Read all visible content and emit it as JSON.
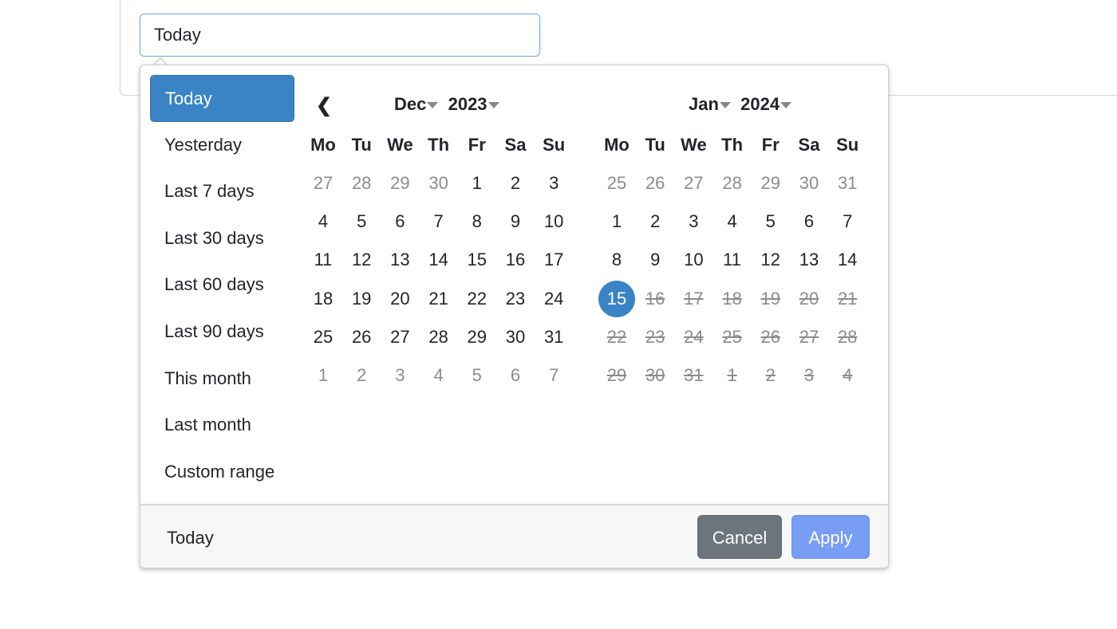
{
  "input": {
    "value": "Today"
  },
  "ranges": [
    {
      "label": "Today",
      "active": true
    },
    {
      "label": "Yesterday"
    },
    {
      "label": "Last 7 days"
    },
    {
      "label": "Last 30 days"
    },
    {
      "label": "Last 60 days"
    },
    {
      "label": "Last 90 days"
    },
    {
      "label": "This month"
    },
    {
      "label": "Last month"
    },
    {
      "label": "Custom range"
    }
  ],
  "weekdays": [
    "Mo",
    "Tu",
    "We",
    "Th",
    "Fr",
    "Sa",
    "Su"
  ],
  "prev_icon": "chevron-left-icon",
  "calendars": [
    {
      "month": "Dec",
      "year": "2023",
      "weeks": [
        [
          {
            "d": "27",
            "s": "off"
          },
          {
            "d": "28",
            "s": "off"
          },
          {
            "d": "29",
            "s": "off"
          },
          {
            "d": "30",
            "s": "off"
          },
          {
            "d": "1"
          },
          {
            "d": "2"
          },
          {
            "d": "3"
          }
        ],
        [
          {
            "d": "4"
          },
          {
            "d": "5"
          },
          {
            "d": "6"
          },
          {
            "d": "7"
          },
          {
            "d": "8"
          },
          {
            "d": "9"
          },
          {
            "d": "10"
          }
        ],
        [
          {
            "d": "11"
          },
          {
            "d": "12"
          },
          {
            "d": "13"
          },
          {
            "d": "14"
          },
          {
            "d": "15"
          },
          {
            "d": "16"
          },
          {
            "d": "17"
          }
        ],
        [
          {
            "d": "18"
          },
          {
            "d": "19"
          },
          {
            "d": "20"
          },
          {
            "d": "21"
          },
          {
            "d": "22"
          },
          {
            "d": "23"
          },
          {
            "d": "24"
          }
        ],
        [
          {
            "d": "25"
          },
          {
            "d": "26"
          },
          {
            "d": "27"
          },
          {
            "d": "28"
          },
          {
            "d": "29"
          },
          {
            "d": "30"
          },
          {
            "d": "31"
          }
        ],
        [
          {
            "d": "1",
            "s": "off"
          },
          {
            "d": "2",
            "s": "off"
          },
          {
            "d": "3",
            "s": "off"
          },
          {
            "d": "4",
            "s": "off"
          },
          {
            "d": "5",
            "s": "off"
          },
          {
            "d": "6",
            "s": "off"
          },
          {
            "d": "7",
            "s": "off"
          }
        ]
      ]
    },
    {
      "month": "Jan",
      "year": "2024",
      "weeks": [
        [
          {
            "d": "25",
            "s": "off"
          },
          {
            "d": "26",
            "s": "off"
          },
          {
            "d": "27",
            "s": "off"
          },
          {
            "d": "28",
            "s": "off"
          },
          {
            "d": "29",
            "s": "off"
          },
          {
            "d": "30",
            "s": "off"
          },
          {
            "d": "31",
            "s": "off"
          }
        ],
        [
          {
            "d": "1"
          },
          {
            "d": "2"
          },
          {
            "d": "3"
          },
          {
            "d": "4"
          },
          {
            "d": "5"
          },
          {
            "d": "6"
          },
          {
            "d": "7"
          }
        ],
        [
          {
            "d": "8"
          },
          {
            "d": "9"
          },
          {
            "d": "10"
          },
          {
            "d": "11"
          },
          {
            "d": "12"
          },
          {
            "d": "13"
          },
          {
            "d": "14"
          }
        ],
        [
          {
            "d": "15",
            "s": "active"
          },
          {
            "d": "16",
            "s": "disabled"
          },
          {
            "d": "17",
            "s": "disabled"
          },
          {
            "d": "18",
            "s": "disabled"
          },
          {
            "d": "19",
            "s": "disabled"
          },
          {
            "d": "20",
            "s": "disabled"
          },
          {
            "d": "21",
            "s": "disabled"
          }
        ],
        [
          {
            "d": "22",
            "s": "disabled"
          },
          {
            "d": "23",
            "s": "disabled"
          },
          {
            "d": "24",
            "s": "disabled"
          },
          {
            "d": "25",
            "s": "disabled"
          },
          {
            "d": "26",
            "s": "disabled"
          },
          {
            "d": "27",
            "s": "disabled"
          },
          {
            "d": "28",
            "s": "disabled"
          }
        ],
        [
          {
            "d": "29",
            "s": "disabled"
          },
          {
            "d": "30",
            "s": "disabled"
          },
          {
            "d": "31",
            "s": "disabled"
          },
          {
            "d": "1",
            "s": "disabled"
          },
          {
            "d": "2",
            "s": "disabled"
          },
          {
            "d": "3",
            "s": "disabled"
          },
          {
            "d": "4",
            "s": "disabled"
          }
        ]
      ]
    }
  ],
  "footer": {
    "selected": "Today",
    "cancel": "Cancel",
    "apply": "Apply"
  },
  "colors": {
    "accent": "#3a84c6",
    "apply": "#779df5",
    "cancel": "#6c757d"
  }
}
